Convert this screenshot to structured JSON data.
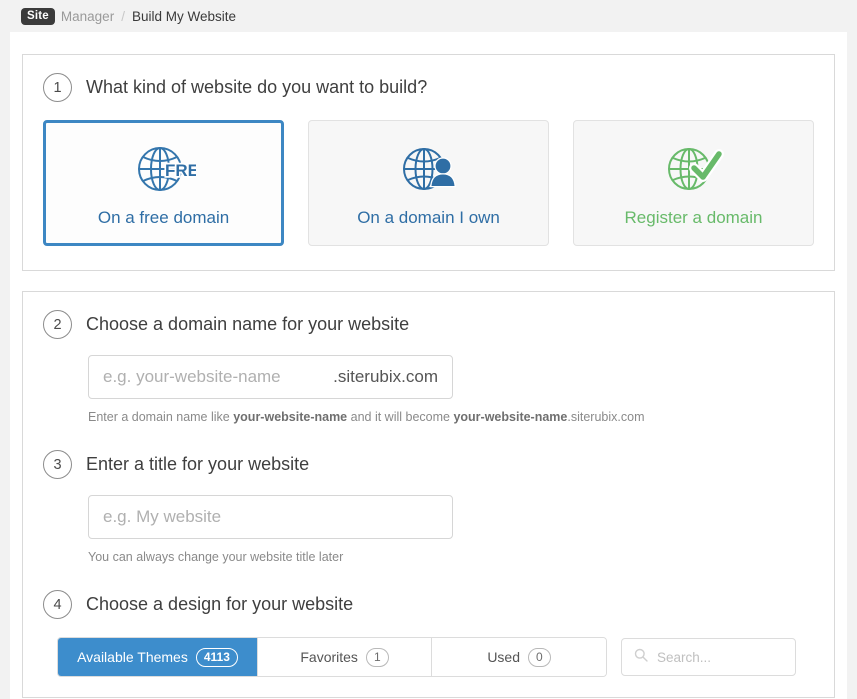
{
  "breadcrumb": {
    "badge": "Site",
    "owner": "Manager",
    "separator": "/",
    "current": "Build My Website"
  },
  "step1": {
    "number": "1",
    "title": "What kind of website do you want to build?",
    "options": [
      {
        "icon": "globe-free-icon",
        "label": "On a free domain",
        "selected": true
      },
      {
        "icon": "globe-person-icon",
        "label": "On a domain I own",
        "selected": false
      },
      {
        "icon": "globe-check-icon",
        "label": "Register a domain",
        "selected": false
      }
    ]
  },
  "step2": {
    "number": "2",
    "title": "Choose a domain name for your website",
    "placeholder": "e.g. your-website-name",
    "value": "",
    "suffix": ".siterubix.com",
    "hint_1": "Enter a domain name like ",
    "hint_bold_1": "your-website-name",
    "hint_2": " and it will become ",
    "hint_bold_2": "your-website-name",
    "hint_3": ".siterubix.com"
  },
  "step3": {
    "number": "3",
    "title": "Enter a title for your website",
    "placeholder": "e.g. My website",
    "value": "",
    "hint": "You can always change your website title later"
  },
  "step4": {
    "number": "4",
    "title": "Choose a design for your website",
    "tabs": [
      {
        "label": "Available Themes",
        "count": "4113",
        "active": true
      },
      {
        "label": "Favorites",
        "count": "1",
        "active": false
      },
      {
        "label": "Used",
        "count": "0",
        "active": false
      }
    ],
    "search_placeholder": "Search...",
    "search_value": ""
  },
  "colors": {
    "accent_blue": "#3d8dcc",
    "selected_border": "#3d87c3",
    "green": "#68ba6a",
    "text": "#3a3a3a",
    "muted": "#8a8a8a"
  }
}
